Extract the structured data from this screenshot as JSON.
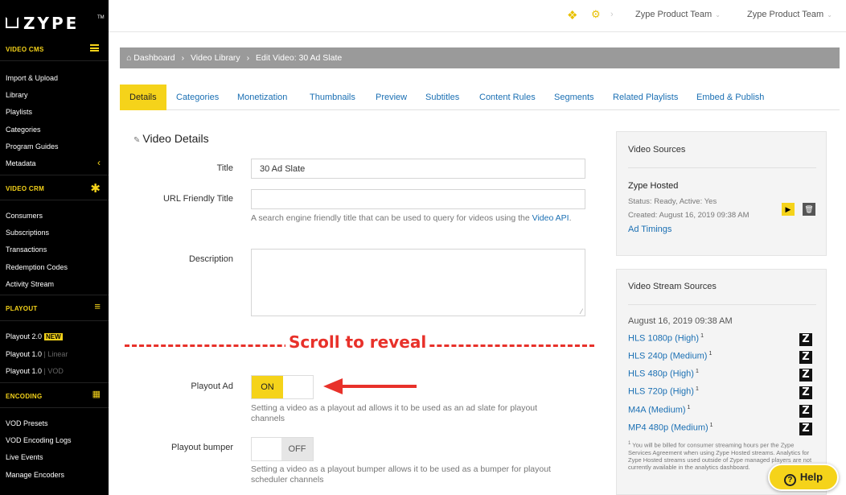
{
  "logo": {
    "text": "ZYPE",
    "tm": "TM"
  },
  "sidebar": {
    "video_cms": {
      "heading": "VIDEO CMS",
      "items": [
        "Import & Upload",
        "Library",
        "Playlists",
        "Categories",
        "Program Guides",
        "Metadata"
      ]
    },
    "video_crm": {
      "heading": "VIDEO CRM",
      "items": [
        "Consumers",
        "Subscriptions",
        "Transactions",
        "Redemption Codes",
        "Activity Stream"
      ]
    },
    "playout": {
      "heading": "PLAYOUT",
      "items": [
        {
          "label": "Playout 2.0",
          "badge": "NEW",
          "dim": ""
        },
        {
          "label": "Playout 1.0",
          "badge": "",
          "dim": "Linear"
        },
        {
          "label": "Playout 1.0",
          "badge": "",
          "dim": "VOD"
        }
      ]
    },
    "encoding": {
      "heading": "ENCODING",
      "items": [
        "VOD Presets",
        "VOD Encoding Logs",
        "Live Events",
        "Manage Encoders"
      ]
    }
  },
  "topbar": {
    "team1": "Zype Product Team",
    "team2": "Zype Product Team"
  },
  "breadcrumb": {
    "home": "Dashboard",
    "library": "Video Library",
    "current": "Edit Video: 30 Ad Slate"
  },
  "tabs": [
    "Details",
    "Categories",
    "Monetization",
    "Thumbnails",
    "Preview",
    "Subtitles",
    "Content Rules",
    "Segments",
    "Related Playlists",
    "Embed & Publish"
  ],
  "form": {
    "section_title": "Video Details",
    "title_label": "Title",
    "title_value": "30 Ad Slate",
    "url_label": "URL Friendly Title",
    "url_help": "A search engine friendly title that can be used to query for videos using the",
    "url_help_link": "Video API",
    "description_label": "Description",
    "scroll_note": "Scroll to reveal",
    "playout_ad_label": "Playout Ad",
    "playout_ad_state": "ON",
    "playout_ad_help": "Setting a video as a playout ad allows it to be used as an ad slate for playout channels",
    "bumper_label": "Playout bumper",
    "bumper_state": "OFF",
    "bumper_help": "Setting a video as a playout bumper allows it to be used as a bumper for playout scheduler channels"
  },
  "video_sources": {
    "title": "Video Sources",
    "name": "Zype Hosted",
    "status": "Status: Ready, Active: Yes",
    "created": "Created: August 16, 2019 09:38 AM",
    "link": "Ad Timings"
  },
  "stream_sources": {
    "title": "Video Stream Sources",
    "date": "August 16, 2019 09:38 AM",
    "items": [
      "HLS 1080p (High)",
      "HLS 240p (Medium)",
      "HLS 480p (High)",
      "HLS 720p (High)",
      "M4A (Medium)",
      "MP4 480p (Medium)"
    ],
    "footnote": "You will be billed for consumer streaming hours per the Zype Services Agreement when using Zype Hosted streams. Analytics for Zype Hosted streams used outside of Zype managed players are not currently available in the analytics dashboard."
  },
  "help_button": "Help",
  "colors": {
    "accent": "#f5d31a",
    "link": "#1a6fb3",
    "annotation": "#e8312a"
  }
}
